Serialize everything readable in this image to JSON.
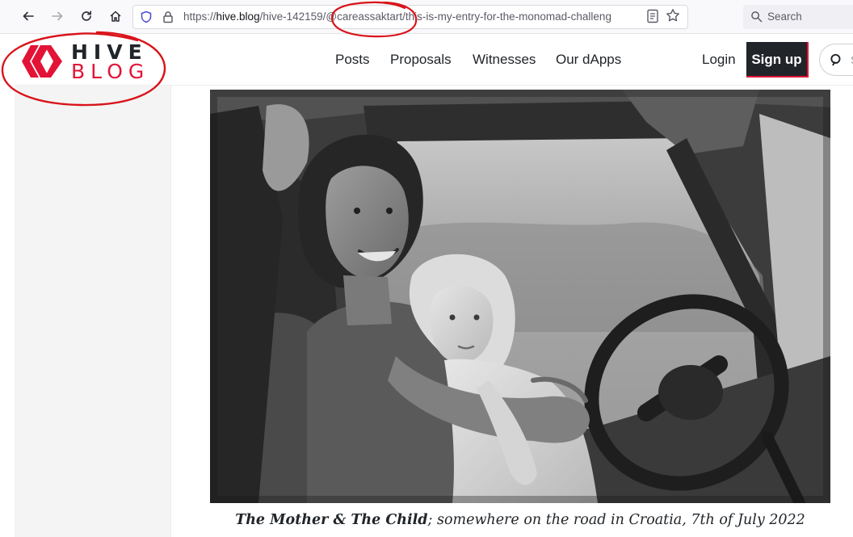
{
  "browser": {
    "url_prefix": "https://",
    "url_host": "hive.blog",
    "url_path": "/hive-142159/@careassaktart/this-is-my-entry-for-the-monomad-challeng",
    "search_label": "Search"
  },
  "site": {
    "logo_top": "HIVE",
    "logo_bottom": "BLOG",
    "nav": [
      "Posts",
      "Proposals",
      "Witnesses",
      "Our dApps"
    ],
    "login_label": "Login",
    "signup_label": "Sign up",
    "search_hint": "S"
  },
  "post": {
    "caption_bold": "The Mother & The Child",
    "caption_rest": "; somewhere on the road in Croatia, 7th of July 2022"
  },
  "colors": {
    "brand_red": "#e31337",
    "dark": "#212529",
    "annotation_red": "#d9141b"
  }
}
